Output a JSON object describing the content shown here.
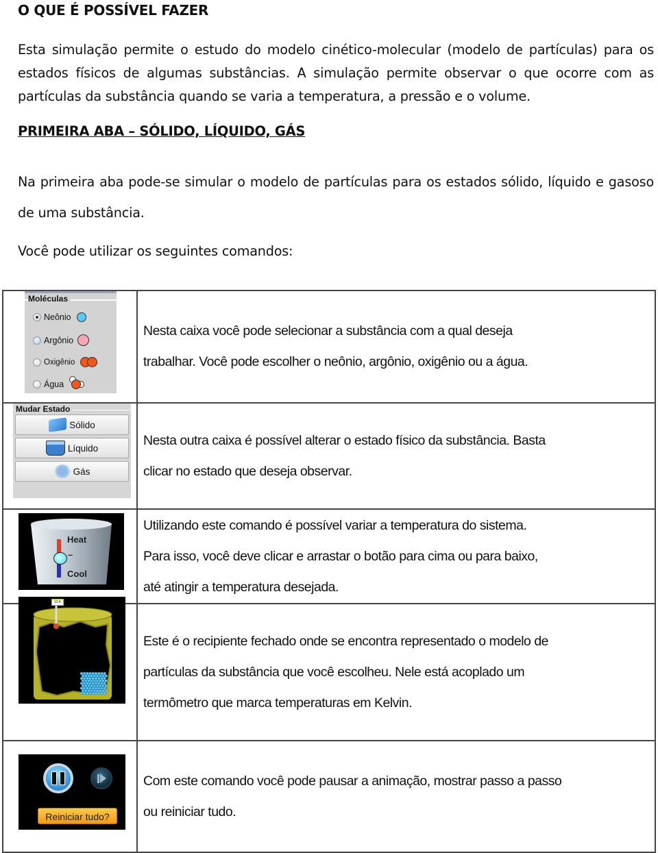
{
  "heading1": "O QUE É POSSÍVEL FAZER",
  "intro": "Esta simulação permite o estudo do modelo cinético-molecular (modelo de partículas) para os estados físicos de algumas substâncias. A simulação permite observar o que ocorre com as partículas da substância quando se varia a temperatura, a pressão e o volume.",
  "heading2": "PRIMEIRA ABA – SÓLIDO, LÍQUIDO, GÁS",
  "para2": "Na primeira aba pode-se simular o modelo de partículas para os estados sólido, líquido e gasoso de uma substância.",
  "para3": "Você pode utilizar os seguintes comandos:",
  "molecules_panel": {
    "title": "Moléculas",
    "selected": "Neônio",
    "options": [
      {
        "label": "Neônio",
        "icon": "neon-atom-icon",
        "color": "#5bc8f5"
      },
      {
        "label": "Argônio",
        "icon": "argon-atom-icon",
        "color": "#f7a8b0"
      },
      {
        "label": "Oxigênio",
        "icon": "oxygen-molecule-icon",
        "color": "#f2561d"
      },
      {
        "label": "Água",
        "icon": "water-molecule-icon",
        "color": "#f2561d"
      }
    ]
  },
  "state_panel": {
    "title": "Mudar Estado",
    "buttons": [
      {
        "label": "Sólido",
        "icon": "ice-cube-icon"
      },
      {
        "label": "Líquido",
        "icon": "liquid-bucket-icon"
      },
      {
        "label": "Gás",
        "icon": "gas-cloud-icon"
      }
    ]
  },
  "heat_control": {
    "heat_label": "Heat",
    "cool_label": "Cool",
    "dash": "–"
  },
  "container": {
    "thermometer_reading": "13 K"
  },
  "playback": {
    "reset_label": "Reiniciar tudo?",
    "pause_icon": "pause-icon",
    "step_icon": "step-forward-icon"
  },
  "rows": [
    {
      "lines": [
        "Nesta caixa você pode selecionar a substância com a qual deseja",
        "trabalhar. Você pode escolher o neônio, argônio, oxigênio ou a água."
      ]
    },
    {
      "lines": [
        "Nesta outra caixa é possível alterar o estado físico da substância. Basta",
        "clicar no estado que deseja observar."
      ]
    },
    {
      "lines": [
        "Utilizando este comando é possível variar a temperatura do sistema.",
        "Para isso, você deve clicar e arrastar o botão para cima ou para baixo,",
        "até atingir a temperatura desejada."
      ]
    },
    {
      "lines": [
        "Este é o recipiente fechado onde se encontra representado o modelo de",
        "partículas da substância que você escolheu. Nele está acoplado um",
        "termômetro que marca temperaturas em Kelvin."
      ]
    },
    {
      "lines": [
        "Com este comando você pode pausar a animação, mostrar passo a passo",
        "ou reiniciar tudo."
      ]
    }
  ]
}
